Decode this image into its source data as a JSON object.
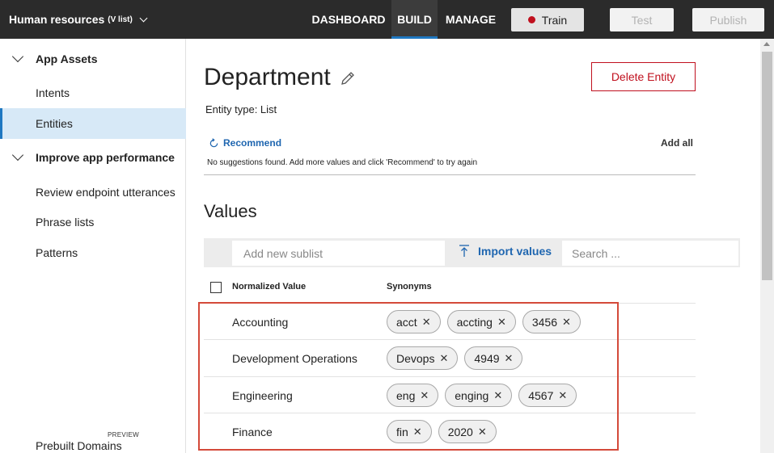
{
  "topbar": {
    "app_name": "Human resources",
    "app_version": "(V list)",
    "nav": {
      "dashboard": "DASHBOARD",
      "build": "BUILD",
      "manage": "MANAGE"
    },
    "train_label": "Train",
    "test_label": "Test",
    "publish_label": "Publish",
    "colors": {
      "background": "#2b2b2b",
      "active_underline": "#1f78c1",
      "train_dot": "#c0101e"
    }
  },
  "sidebar": {
    "group_app_assets": "App Assets",
    "intents": "Intents",
    "entities": "Entities",
    "group_improve": "Improve app performance",
    "review_utterances": "Review endpoint utterances",
    "phrase_lists": "Phrase lists",
    "patterns": "Patterns",
    "prebuilt_domains": "Prebuilt Domains",
    "preview_badge": "PREVIEW",
    "active_item": "Entities"
  },
  "entity": {
    "title": "Department",
    "delete_label": "Delete Entity",
    "type_text": "Entity type: List"
  },
  "recommend": {
    "label": "Recommend",
    "add_all": "Add all",
    "message": "No suggestions found. Add more values and click 'Recommend' to try again"
  },
  "values": {
    "heading": "Values",
    "sublist_placeholder": "Add new sublist",
    "import_label": "Import values",
    "search_placeholder": "Search ...",
    "col_normalized": "Normalized Value",
    "col_synonyms": "Synonyms",
    "rows": [
      {
        "name": "Accounting",
        "synonyms": [
          "acct",
          "accting",
          "3456"
        ]
      },
      {
        "name": "Development Operations",
        "synonyms": [
          "Devops",
          "4949"
        ]
      },
      {
        "name": "Engineering",
        "synonyms": [
          "eng",
          "enging",
          "4567"
        ]
      },
      {
        "name": "Finance",
        "synonyms": [
          "fin",
          "2020"
        ]
      }
    ]
  },
  "icons": {
    "dropdown": "chevron-down-icon",
    "edit": "pencil-icon",
    "recommend": "refresh-icon",
    "import": "upload-arrow-icon",
    "remove": "close-icon"
  },
  "colors": {
    "accent": "#1f66b0",
    "danger": "#c0101e",
    "highlight_box": "#d44a3a",
    "selected_bg": "#d7e9f7"
  }
}
